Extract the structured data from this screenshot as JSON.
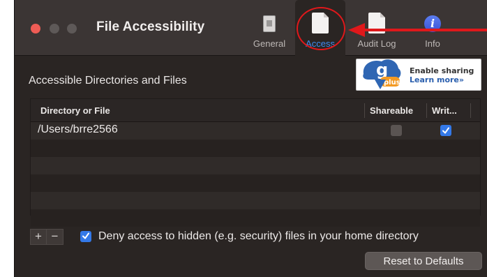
{
  "window": {
    "title": "File Accessibility"
  },
  "toolbar": {
    "tabs": [
      {
        "label": "General",
        "icon": "general-prefs-icon"
      },
      {
        "label": "Access",
        "icon": "document-icon",
        "selected": true
      },
      {
        "label": "Audit Log",
        "icon": "document-icon"
      },
      {
        "label": "Info",
        "icon": "info-icon"
      }
    ]
  },
  "main": {
    "section_title": "Accessible Directories and Files",
    "globus_banner": {
      "logo_letter": "g",
      "logo_sub": "plus",
      "line1": "Enable sharing",
      "line2": "Learn more»"
    },
    "table": {
      "columns": [
        "Directory or File",
        "Shareable",
        "Writ..."
      ],
      "rows": [
        {
          "path": "/Users/brre2566",
          "shareable": false,
          "writable": true
        }
      ]
    },
    "add_label": "+",
    "remove_label": "−",
    "deny_hidden": {
      "checked": true,
      "label": "Deny access to hidden (e.g. security) files in your home directory"
    },
    "reset_label": "Reset to Defaults"
  },
  "colors": {
    "accent": "#3479e8",
    "annotation": "#e0181b",
    "window_bg": "#2a2523",
    "toolbar_bg": "#3b3534"
  }
}
